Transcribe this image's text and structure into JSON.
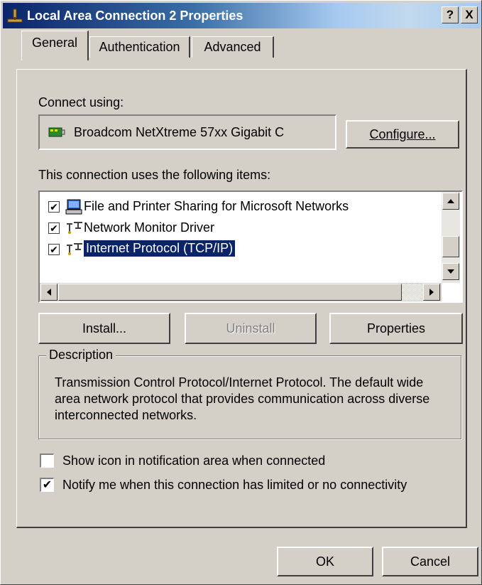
{
  "window": {
    "title": "Local Area Connection 2 Properties",
    "help_label": "?",
    "close_label": "X"
  },
  "tabs": [
    {
      "label": "General",
      "active": true
    },
    {
      "label": "Authentication",
      "active": false
    },
    {
      "label": "Advanced",
      "active": false
    }
  ],
  "connect_using": {
    "label": "Connect using:",
    "adapter": "Broadcom NetXtreme 57xx Gigabit C",
    "configure_label": "Configure..."
  },
  "items_section": {
    "label": "This connection uses the following items:",
    "items": [
      {
        "label": "File and Printer Sharing for Microsoft Networks",
        "checked": true,
        "selected": false,
        "icon": "printer-sharing-icon"
      },
      {
        "label": "Network Monitor Driver",
        "checked": true,
        "selected": false,
        "icon": "network-protocol-icon"
      },
      {
        "label": "Internet Protocol (TCP/IP)",
        "checked": true,
        "selected": true,
        "icon": "network-protocol-icon"
      }
    ],
    "check_glyph": "✔"
  },
  "item_buttons": {
    "install": "Install...",
    "uninstall": "Uninstall",
    "properties": "Properties"
  },
  "description": {
    "legend": "Description",
    "text": "Transmission Control Protocol/Internet Protocol. The default wide area network protocol that provides communication across diverse interconnected networks."
  },
  "options": {
    "show_icon": {
      "label": "Show icon in notification area when connected",
      "checked": false
    },
    "notify": {
      "label": "Notify me when this connection has limited or no connectivity",
      "checked": true
    }
  },
  "footer": {
    "ok": "OK",
    "cancel": "Cancel"
  },
  "colors": {
    "selection": "#0a246a",
    "face": "#d4d0c8"
  }
}
